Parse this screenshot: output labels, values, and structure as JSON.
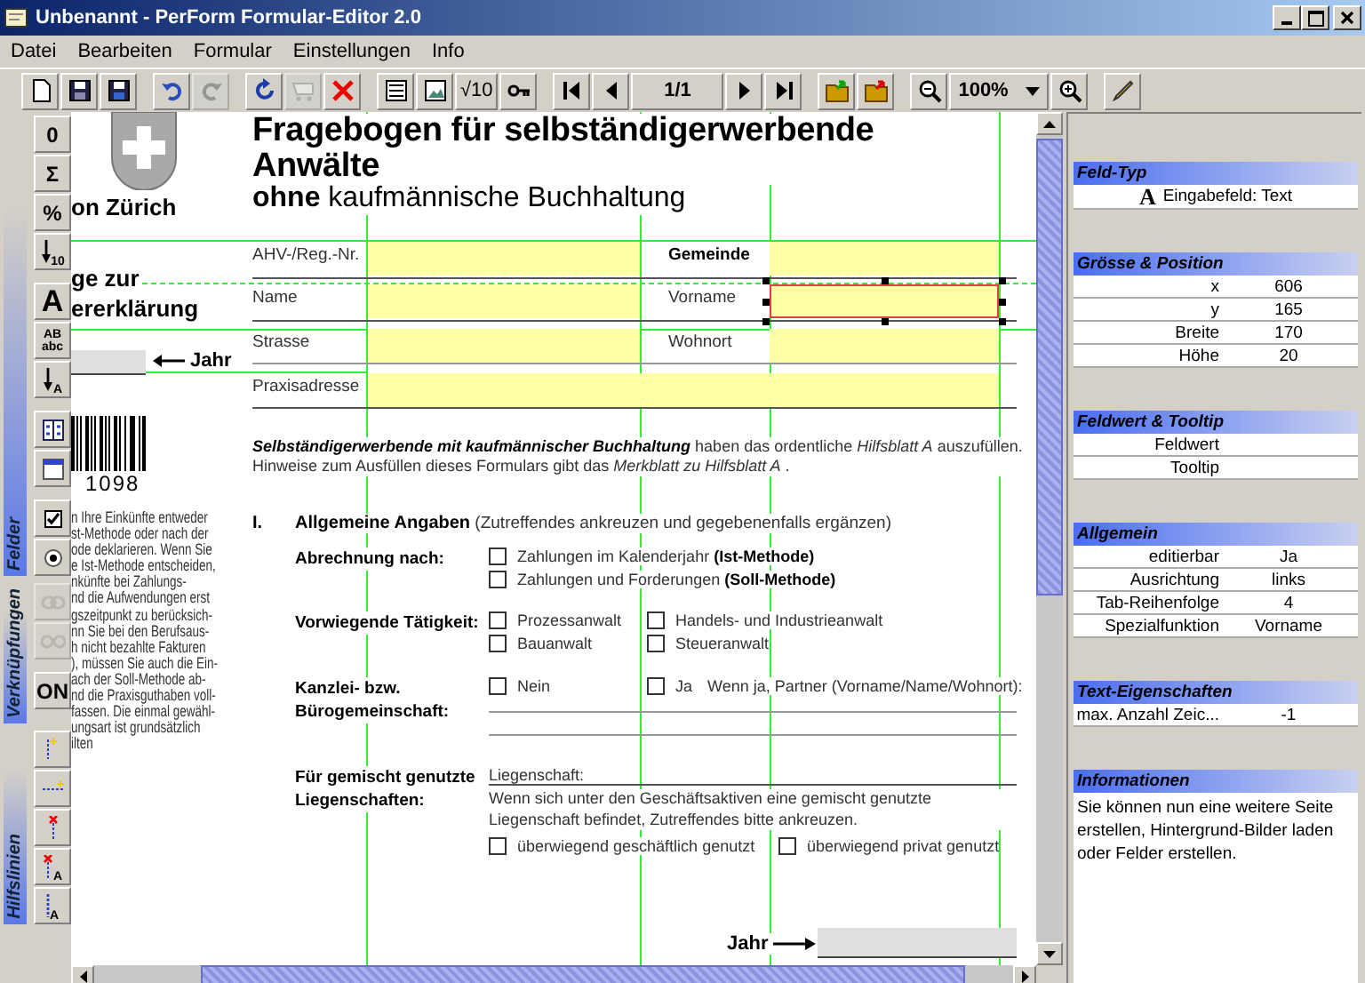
{
  "window": {
    "title": "Unbenannt - PerForm Formular-Editor 2.0"
  },
  "menu": [
    "Datei",
    "Bearbeiten",
    "Formular",
    "Einstellungen",
    "Info"
  ],
  "toolbar": [
    [
      {
        "kind": "new",
        "disabled": false
      },
      {
        "kind": "save",
        "disabled": false
      },
      {
        "kind": "save-as",
        "disabled": false
      }
    ],
    [
      {
        "kind": "undo",
        "disabled": false
      },
      {
        "kind": "redo",
        "disabled": true
      }
    ],
    [
      {
        "kind": "refresh",
        "disabled": false
      },
      {
        "kind": "cart",
        "disabled": true
      },
      {
        "kind": "delete",
        "disabled": false
      }
    ],
    [
      {
        "kind": "form",
        "disabled": false
      },
      {
        "kind": "image",
        "disabled": false
      },
      {
        "kind": "formula",
        "label": "√10",
        "disabled": false
      },
      {
        "kind": "key",
        "disabled": false
      }
    ],
    [
      {
        "kind": "first",
        "disabled": false
      },
      {
        "kind": "previous",
        "disabled": false
      },
      {
        "kind": "page",
        "label": "1/1",
        "disabled": false
      },
      {
        "kind": "next",
        "disabled": false
      },
      {
        "kind": "last",
        "disabled": false
      }
    ],
    [
      {
        "kind": "import",
        "disabled": false
      },
      {
        "kind": "export",
        "disabled": false
      }
    ],
    [
      {
        "kind": "zoom-out",
        "disabled": false
      },
      {
        "kind": "zoom",
        "label": "100%",
        "disabled": false
      },
      {
        "kind": "zoom-in",
        "disabled": false
      }
    ],
    [
      {
        "kind": "pen",
        "disabled": false
      }
    ]
  ],
  "sidebar": [
    {
      "label": "Felder",
      "tools": [
        [
          {
            "kind": "number",
            "labels": [
              "0"
            ],
            "disabled": false
          },
          {
            "kind": "sum",
            "labels": [
              "Σ"
            ],
            "disabled": false
          },
          {
            "kind": "percent",
            "labels": [
              "%"
            ],
            "disabled": false
          },
          {
            "kind": "sort-number",
            "labels": [
              "10"
            ],
            "disabled": false
          }
        ],
        [
          {
            "kind": "text",
            "labels": [
              "A"
            ],
            "disabled": false
          },
          {
            "kind": "text-case",
            "labels": [
              "AB",
              "abc"
            ],
            "disabled": false
          },
          {
            "kind": "sort-text",
            "labels": [
              "A"
            ],
            "disabled": false
          }
        ],
        [
          {
            "kind": "list",
            "disabled": false
          },
          {
            "kind": "date",
            "disabled": false
          }
        ],
        [
          {
            "kind": "checkbox",
            "disabled": false
          },
          {
            "kind": "radio",
            "disabled": false
          }
        ]
      ]
    },
    {
      "label": "Verknüpfungen",
      "tools": [
        [
          {
            "kind": "link",
            "disabled": true
          },
          {
            "kind": "unlink",
            "disabled": true
          }
        ],
        [
          {
            "kind": "toggle",
            "labels": [
              "ON"
            ],
            "disabled": false
          }
        ]
      ]
    },
    {
      "label": "Hilfslinien",
      "tools": [
        [
          {
            "kind": "guide-vertical",
            "disabled": false
          },
          {
            "kind": "guide-horizontal",
            "disabled": false
          },
          {
            "kind": "guide-delete",
            "disabled": false
          },
          {
            "kind": "guide-delete-text",
            "labels": [
              "A"
            ],
            "disabled": false
          },
          {
            "kind": "guide-text",
            "labels": [
              "A"
            ],
            "disabled": false
          }
        ]
      ]
    }
  ],
  "document": {
    "logo_caption": "on Zürich",
    "title": "Fragebogen für selbständigerwerbende Anwälte",
    "subtitle": "**ohne** kaufmännische Buchhaltung",
    "side_heading": [
      "ge zur",
      "ererklärung"
    ],
    "year_label": "Jahr",
    "barcode_number": "1098",
    "side_text": [
      "n Ihre Einkünfte entweder",
      "st-Methode oder nach der",
      "ode deklarieren. Wenn Sie",
      "e Ist-Methode entscheiden,",
      "nkünfte bei Zahlungs-",
      "nd die Aufwendungen erst",
      "gszeitpunkt zu berücksich-",
      "nn Sie bei den Berufsaus-",
      "h nicht bezahlte Fakturen",
      "), müssen Sie auch die Ein-",
      "ach der Soll-Methode ab-",
      "nd die Praxisguthaben voll-",
      "fassen. Die einmal gewähl-",
      "ungsart ist grundsätzlich",
      "ilten"
    ],
    "fields": [
      {
        "label": "AHV-/Reg.-Nr.",
        "bold": false,
        "selected": false
      },
      {
        "label": "Gemeinde",
        "bold": true,
        "selected": false
      },
      {
        "label": "Name",
        "bold": false,
        "selected": false
      },
      {
        "label": "Vorname",
        "bold": false,
        "selected": true
      },
      {
        "label": "Strasse",
        "bold": false,
        "selected": false
      },
      {
        "label": "Wohnort",
        "bold": false,
        "selected": false
      },
      {
        "label": "Praxisadresse",
        "bold": false,
        "selected": false
      }
    ],
    "intro": "**Selbständigerwerbende mit kaufmännischer Buchhaltung** haben das ordentliche *Hilfsblatt A* auszufüllen. Hinweise zum Ausfüllen dieses Formulars gibt das *Merkblatt zu Hilfsblatt A* .",
    "section": {
      "number": "I.",
      "title": "**Allgemeine Angaben** (Zutreffendes ankreuzen und gegebenenfalls ergänzen)"
    },
    "questions": [
      {
        "label": "Abrechnung nach:",
        "options": [
          {
            "text": "Zahlungen im Kalenderjahr **(Ist-Methode)**",
            "checked": false
          },
          {
            "text": "Zahlungen und Forderungen **(Soll-Methode)**",
            "checked": false
          }
        ]
      },
      {
        "label": "Vorwiegende Tätigkeit:",
        "options": [
          {
            "text": "Prozessanwalt",
            "checked": false
          },
          {
            "text": "Handels- und Industrieanwalt",
            "checked": false
          },
          {
            "text": "Bauanwalt",
            "checked": false
          },
          {
            "text": "Steueranwalt",
            "checked": false
          }
        ]
      },
      {
        "label": "Kanzlei- bzw. Bürogemeinschaft:",
        "options": [
          {
            "text": "Nein",
            "checked": false
          },
          {
            "text": "Ja",
            "checked": false
          }
        ],
        "note": "Wenn ja, Partner (Vorname/Name/Wohnort):"
      },
      {
        "label": "Für gemischt genutzte Liegenschaften:",
        "field_label": "Liegenschaft:",
        "note": "Wenn sich unter den Geschäftsaktiven eine gemischt genutzte Liegenschaft befindet, Zutreffendes bitte ankreuzen.",
        "options": [
          {
            "text": "überwiegend geschäftlich genutzt",
            "checked": false
          },
          {
            "text": "überwiegend privat genutzt",
            "checked": false
          }
        ]
      }
    ],
    "footer_label": "Jahr"
  },
  "properties": [
    {
      "kind": "type",
      "title": "Feld-Typ",
      "glyph": "A",
      "text": "Eingabefeld: Text"
    },
    {
      "kind": "table",
      "title": "Grösse & Position",
      "rows": [
        {
          "label": "x",
          "value": "606"
        },
        {
          "label": "y",
          "value": "165"
        },
        {
          "label": "Breite",
          "value": "170"
        },
        {
          "label": "Höhe",
          "value": "20"
        }
      ]
    },
    {
      "kind": "table",
      "title": "Feldwert & Tooltip",
      "rows": [
        {
          "label": "Feldwert"
        },
        {
          "label": "Tooltip"
        }
      ]
    },
    {
      "kind": "table",
      "title": "Allgemein",
      "rows": [
        {
          "label": "editierbar",
          "value": "Ja"
        },
        {
          "label": "Ausrichtung",
          "value": "links"
        },
        {
          "label": "Tab-Reihenfolge",
          "value": "4"
        },
        {
          "label": "Spezialfunktion",
          "value": "Vorname"
        }
      ]
    },
    {
      "kind": "table",
      "title": "Text-Eigenschaften",
      "rows": [
        {
          "label": "max. Anzahl Zeic...",
          "value": "-1"
        }
      ]
    },
    {
      "kind": "info",
      "title": "Informationen",
      "text": "Sie können nun eine weitere Seite erstellen, Hintergrund-Bilder laden oder Felder erstellen."
    }
  ]
}
